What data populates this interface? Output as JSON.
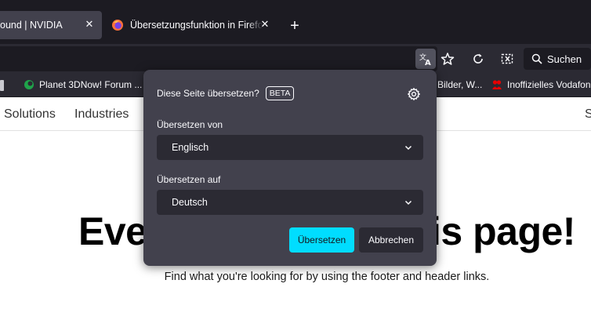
{
  "tabs": [
    {
      "title": "ound | NVIDIA",
      "active": true,
      "close_label": "✕"
    },
    {
      "title": "Übersetzungsfunktion in Firefox",
      "active": false,
      "close_label": "✕"
    }
  ],
  "new_tab_label": "+",
  "toolbar": {
    "translate_icon": "translate-icon",
    "bookmark_icon": "star-icon",
    "reload_icon": "reload-icon",
    "screenshot_icon": "screenshot-icon",
    "search_label": "Suchen"
  },
  "bookmarks": [
    {
      "label": "Planet 3DNow! Forum ...",
      "icon": "planet3dnow-icon"
    },
    {
      "label": "Bilder, W...",
      "icon": "none"
    },
    {
      "label": "Inoffizielles Vodafon",
      "icon": "vodafone-community-icon"
    }
  ],
  "page": {
    "nav": [
      "Solutions",
      "Industries",
      "S"
    ],
    "hero_left": "Ever",
    "hero_right": "is page!",
    "subtitle": "Find what you're looking for by using the footer and header links."
  },
  "translation_panel": {
    "title": "Diese Seite übersetzen?",
    "badge": "BETA",
    "from_label": "Übersetzen von",
    "from_value": "Englisch",
    "to_label": "Übersetzen auf",
    "to_value": "Deutsch",
    "translate_button": "Übersetzen",
    "cancel_button": "Abbrechen"
  },
  "colors": {
    "accent": "#00ddff",
    "panel_bg": "#42414d",
    "toolbar_bg": "#2b2a33",
    "tabstrip_bg": "#1c1b22"
  }
}
